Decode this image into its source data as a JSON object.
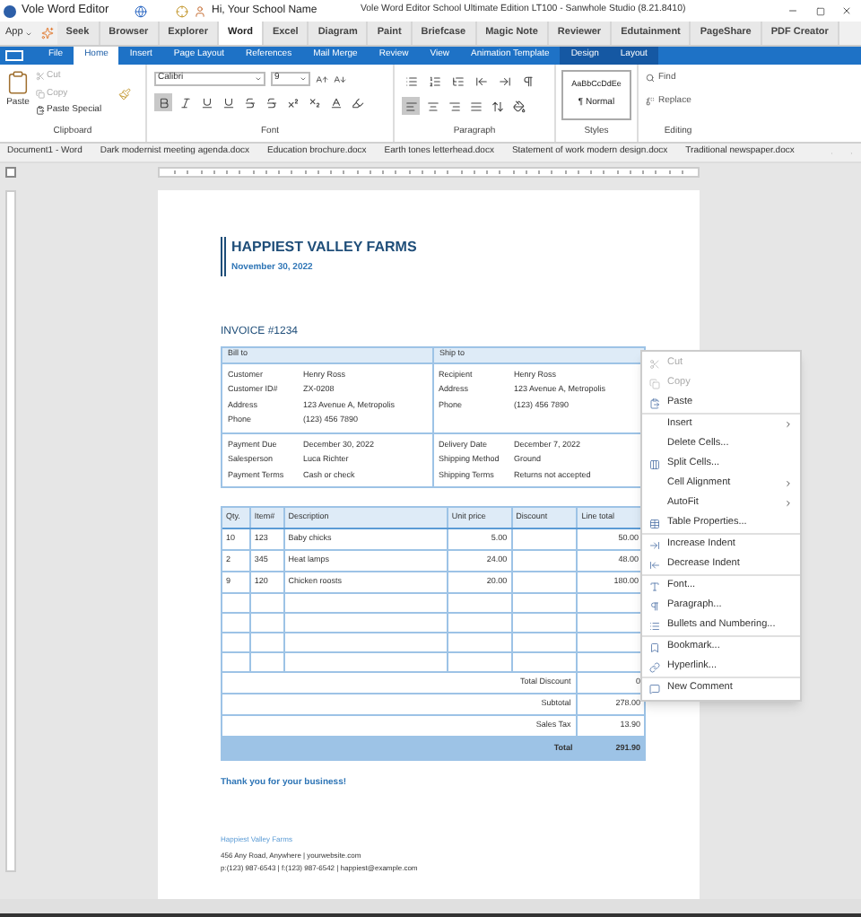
{
  "title_bar": {
    "app_name": "Vole Word Editor",
    "greeting": "Hi, Your School Name",
    "title": "Vole Word Editor School Ultimate Edition LT100 - Sanwhole Studio (8.21.8410)"
  },
  "app_menu": "App",
  "app_tabs": [
    {
      "label": "Seek",
      "selected": false
    },
    {
      "label": "Browser",
      "selected": false
    },
    {
      "label": "Explorer",
      "selected": false
    },
    {
      "label": "Word",
      "selected": true
    },
    {
      "label": "Excel",
      "selected": false
    },
    {
      "label": "Diagram",
      "selected": false
    },
    {
      "label": "Paint",
      "selected": false
    },
    {
      "label": "Briefcase",
      "selected": false
    },
    {
      "label": "Magic Note",
      "selected": false
    },
    {
      "label": "Reviewer",
      "selected": false
    },
    {
      "label": "Edutainment",
      "selected": false
    },
    {
      "label": "PageShare",
      "selected": false
    },
    {
      "label": "PDF Creator",
      "selected": false
    }
  ],
  "ribbon_tabs": [
    {
      "label": "File",
      "selected": false,
      "contextual": false
    },
    {
      "label": "Home",
      "selected": true,
      "contextual": false
    },
    {
      "label": "Insert",
      "selected": false,
      "contextual": false
    },
    {
      "label": "Page Layout",
      "selected": false,
      "contextual": false
    },
    {
      "label": "References",
      "selected": false,
      "contextual": false
    },
    {
      "label": "Mail Merge",
      "selected": false,
      "contextual": false
    },
    {
      "label": "Review",
      "selected": false,
      "contextual": false
    },
    {
      "label": "View",
      "selected": false,
      "contextual": false
    },
    {
      "label": "Animation Template",
      "selected": false,
      "contextual": false
    },
    {
      "label": "Design",
      "selected": false,
      "contextual": true
    },
    {
      "label": "Layout",
      "selected": false,
      "contextual": true
    }
  ],
  "ribbon": {
    "clipboard": {
      "label": "Clipboard",
      "paste": "Paste",
      "items": [
        {
          "label": "Cut",
          "disabled": true
        },
        {
          "label": "Copy",
          "disabled": true
        },
        {
          "label": "Paste Special",
          "disabled": false
        }
      ]
    },
    "font": {
      "label": "Font",
      "family": "Calibri",
      "size": "9",
      "bold": true
    },
    "paragraph": {
      "label": "Paragraph",
      "align_left": true
    },
    "styles": {
      "label": "Styles",
      "preview": "AaBbCcDdEe",
      "current": "¶ Normal"
    },
    "editing": {
      "label": "Editing",
      "items": [
        "Find",
        "Replace"
      ]
    }
  },
  "doc_tabs": [
    "Document1 - Word",
    "Dark modernist meeting agenda.docx",
    "Education brochure.docx",
    "Earth tones letterhead.docx",
    "Statement of work modern design.docx",
    "Traditional newspaper.docx"
  ],
  "document": {
    "company": "HAPPIEST VALLEY FARMS",
    "date": "November 30, 2022",
    "invoice_title": "INVOICE #1234",
    "bill_to": {
      "heading": "Bill to",
      "fields": [
        [
          "Customer",
          "Henry Ross"
        ],
        [
          "Customer ID#",
          "ZX-0208"
        ],
        [
          "Address",
          "123 Avenue A, Metropolis"
        ],
        [
          "Phone",
          "(123) 456 7890"
        ]
      ]
    },
    "ship_to": {
      "heading": "Ship to",
      "fields": [
        [
          "Recipient",
          "Henry Ross"
        ],
        [
          "Address",
          "123 Avenue A, Metropolis"
        ],
        [
          "Phone",
          "(123) 456 7890"
        ]
      ]
    },
    "payment": [
      [
        "Payment Due",
        "December 30, 2022"
      ],
      [
        "Salesperson",
        "Luca Richter"
      ],
      [
        "Payment Terms",
        "Cash or check"
      ]
    ],
    "delivery": [
      [
        "Delivery Date",
        "December 7, 2022"
      ],
      [
        "Shipping Method",
        "Ground"
      ],
      [
        "Shipping Terms",
        "Returns not accepted"
      ]
    ],
    "item_columns": [
      "Qty.",
      "Item#",
      "Description",
      "Unit price",
      "Discount",
      "Line total"
    ],
    "items": [
      {
        "qty": "10",
        "item": "123",
        "description": "Baby chicks",
        "unit_price": "5.00",
        "line_total": "50.00"
      },
      {
        "qty": "2",
        "item": "345",
        "description": "Heat lamps",
        "unit_price": "24.00",
        "line_total": "48.00"
      },
      {
        "qty": "9",
        "item": "120",
        "description": "Chicken roosts",
        "unit_price": "20.00",
        "line_total": "180.00"
      },
      {
        "blank": true
      },
      {
        "blank": true
      },
      {
        "blank": true
      },
      {
        "blank": true
      }
    ],
    "summary": [
      {
        "label": "Total Discount",
        "value": "0"
      },
      {
        "label": "Subtotal",
        "value": "278.00"
      },
      {
        "label": "Sales Tax",
        "value": "13.90"
      }
    ],
    "total": {
      "label": "Total",
      "value": "291.90"
    },
    "thanks": "Thank you for your business!",
    "footer_name": "Happiest Valley Farms",
    "footer_address": "456 Any Road, Anywhere | yourwebsite.com",
    "footer_contact": "p:(123) 987-6543 | f:(123) 987-6542 | happiest@example.com"
  },
  "context_menu": [
    [
      {
        "label": "Cut",
        "disabled": true,
        "submenu": false
      },
      {
        "label": "Copy",
        "disabled": true,
        "submenu": false
      },
      {
        "label": "Paste",
        "disabled": false,
        "submenu": false
      }
    ],
    [
      {
        "label": "Insert",
        "disabled": false,
        "submenu": true
      },
      {
        "label": "Delete Cells...",
        "disabled": false,
        "submenu": false
      },
      {
        "label": "Split Cells...",
        "disabled": false,
        "submenu": false
      },
      {
        "label": "Cell Alignment",
        "disabled": false,
        "submenu": true
      },
      {
        "label": "AutoFit",
        "disabled": false,
        "submenu": true
      },
      {
        "label": "Table Properties...",
        "disabled": false,
        "submenu": false
      }
    ],
    [
      {
        "label": "Increase Indent",
        "disabled": false,
        "submenu": false
      },
      {
        "label": "Decrease Indent",
        "disabled": false,
        "submenu": false
      }
    ],
    [
      {
        "label": "Font...",
        "disabled": false,
        "submenu": false
      },
      {
        "label": "Paragraph...",
        "disabled": false,
        "submenu": false
      },
      {
        "label": "Bullets and Numbering...",
        "disabled": false,
        "submenu": false
      }
    ],
    [
      {
        "label": "Bookmark...",
        "disabled": false,
        "submenu": false
      },
      {
        "label": "Hyperlink...",
        "disabled": false,
        "submenu": false
      }
    ],
    [
      {
        "label": "New Comment",
        "disabled": false,
        "submenu": false
      }
    ]
  ]
}
